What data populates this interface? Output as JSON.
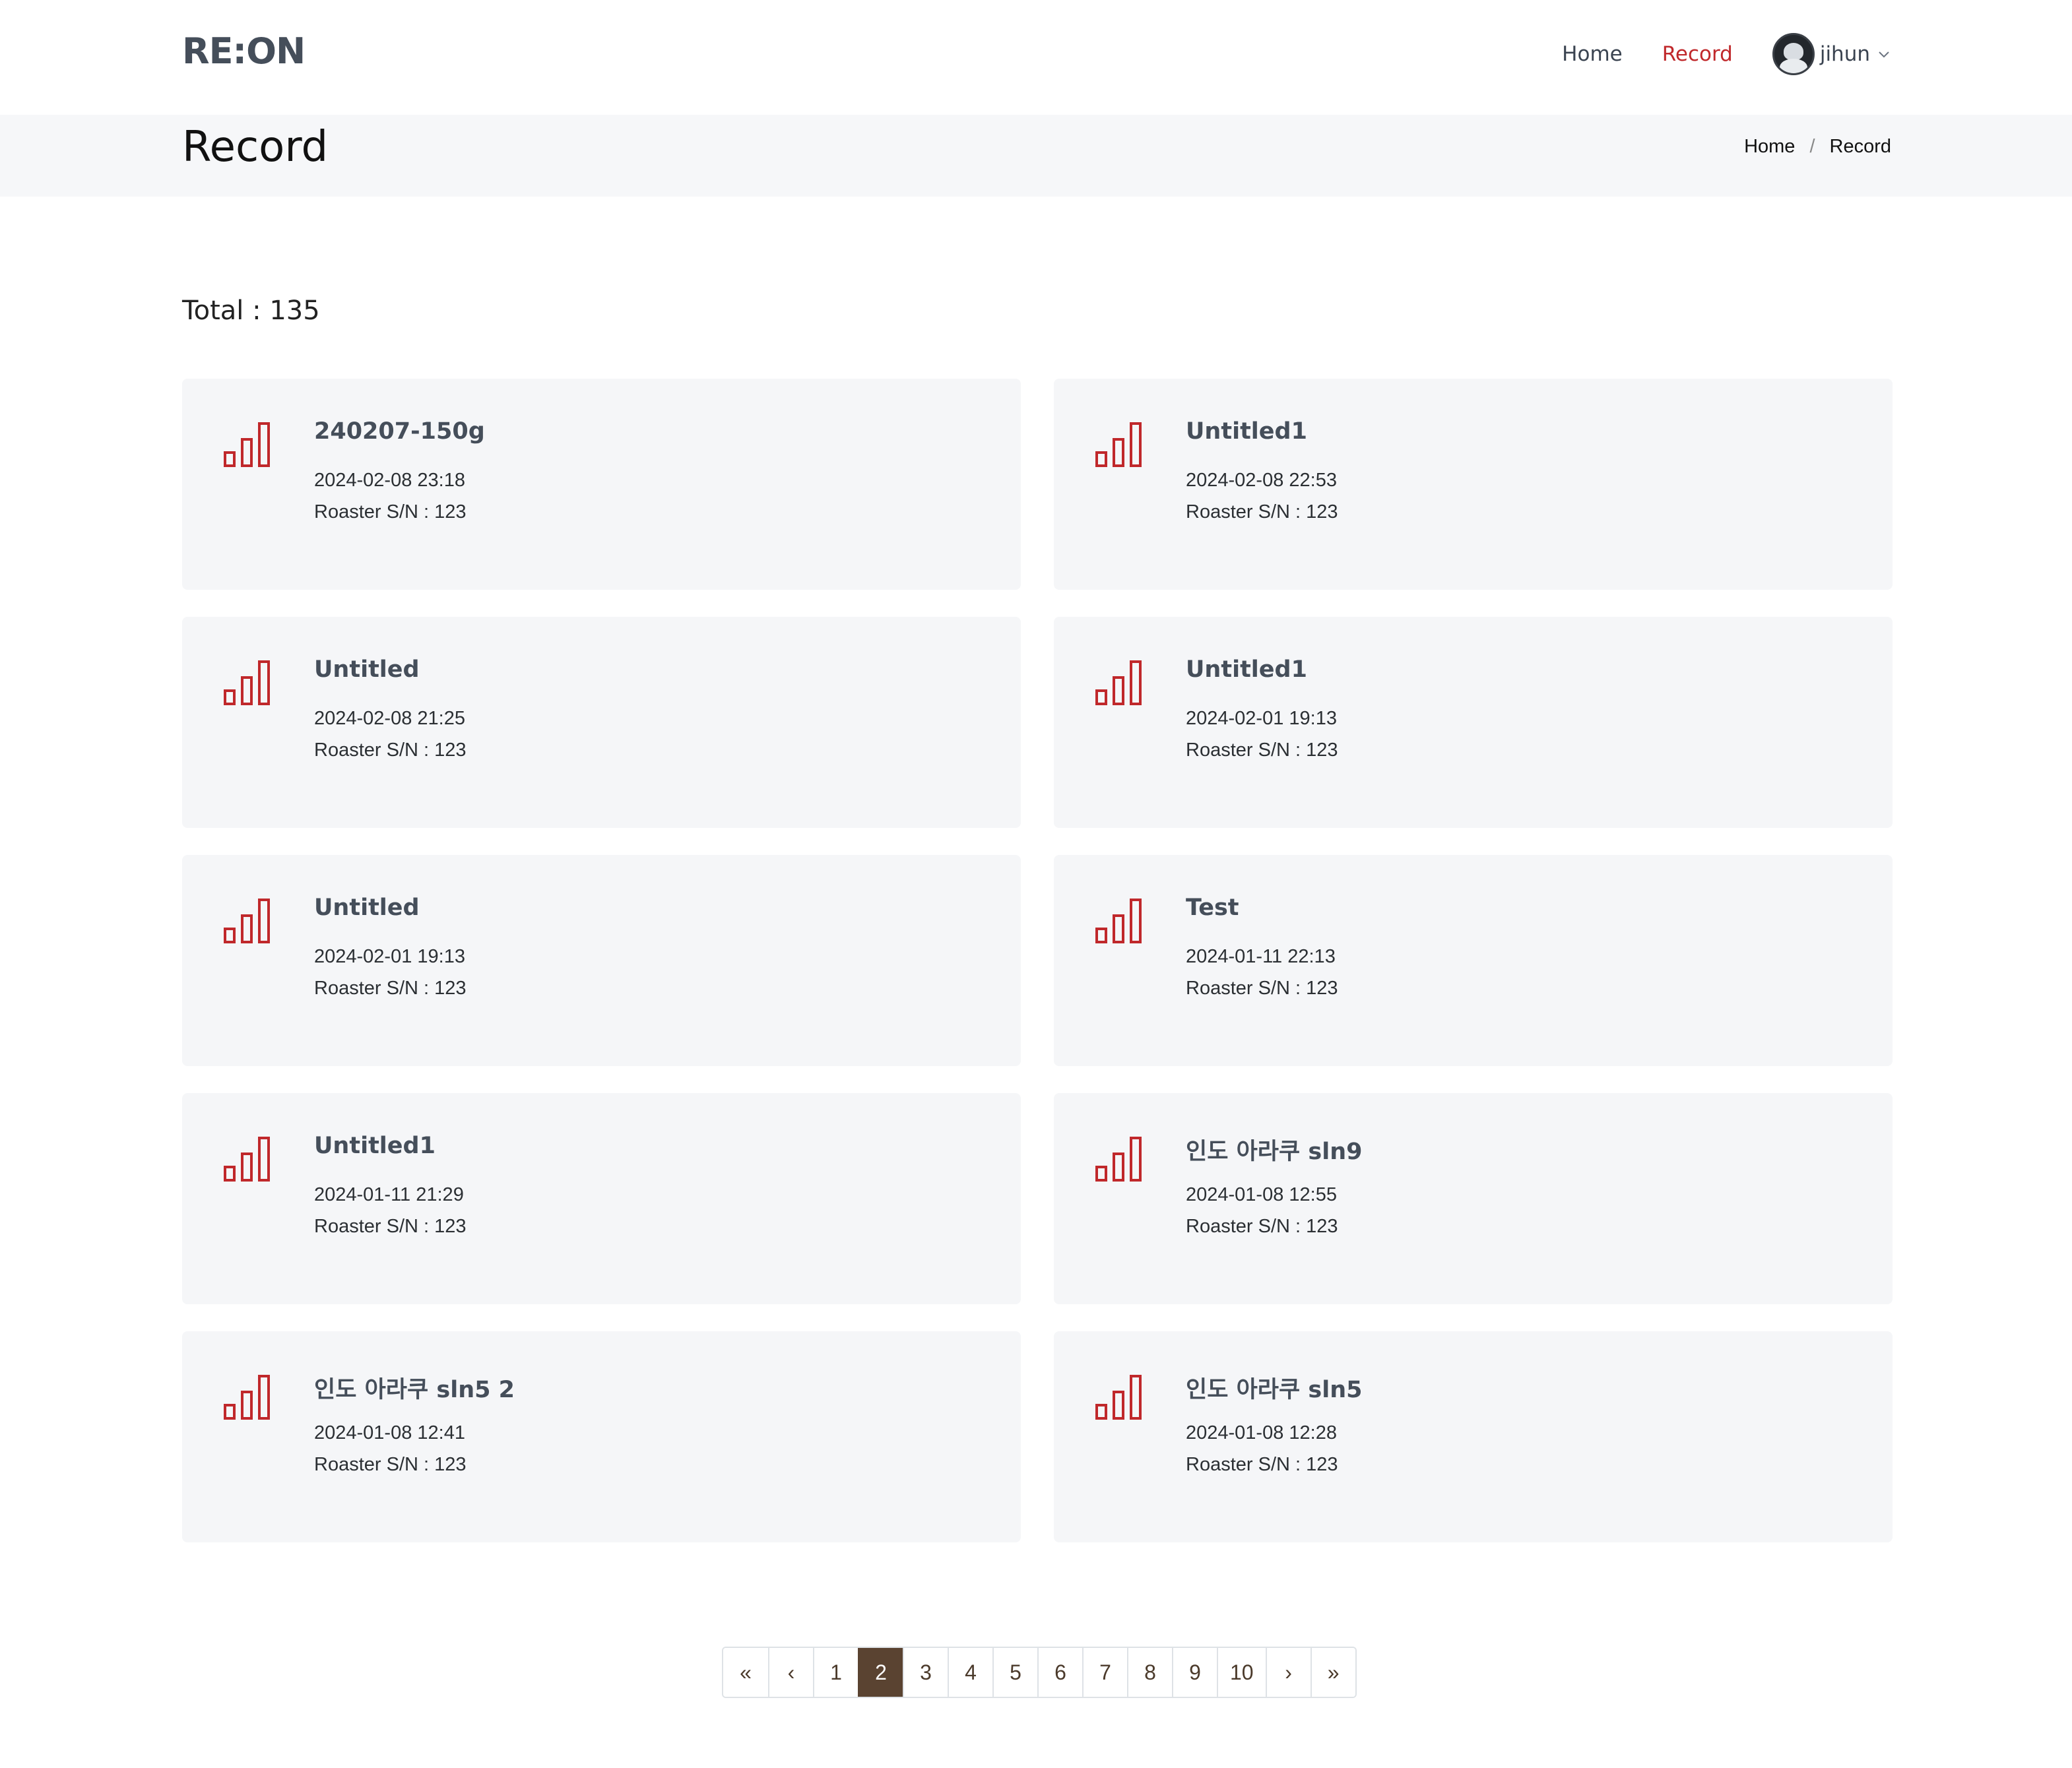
{
  "header": {
    "logo": "RE:ON",
    "nav": [
      {
        "label": "Home",
        "active": false
      },
      {
        "label": "Record",
        "active": true
      }
    ],
    "user": {
      "name": "jihun"
    }
  },
  "titlebar": {
    "title": "Record",
    "breadcrumb": [
      "Home",
      "/",
      "Record"
    ]
  },
  "total_label": "Total : 135",
  "records": [
    {
      "title": "240207-150g",
      "date": "2024-02-08 23:18",
      "sn": "Roaster S/N : 123"
    },
    {
      "title": "Untitled1",
      "date": "2024-02-08 22:53",
      "sn": "Roaster S/N : 123"
    },
    {
      "title": "Untitled",
      "date": "2024-02-08 21:25",
      "sn": "Roaster S/N : 123"
    },
    {
      "title": "Untitled1",
      "date": "2024-02-01 19:13",
      "sn": "Roaster S/N : 123"
    },
    {
      "title": "Untitled",
      "date": "2024-02-01 19:13",
      "sn": "Roaster S/N : 123"
    },
    {
      "title": "Test",
      "date": "2024-01-11 22:13",
      "sn": "Roaster S/N : 123"
    },
    {
      "title": "Untitled1",
      "date": "2024-01-11 21:29",
      "sn": "Roaster S/N : 123"
    },
    {
      "title": "인도 아라쿠 sln9",
      "date": "2024-01-08 12:55",
      "sn": "Roaster S/N : 123"
    },
    {
      "title": "인도 아라쿠 sln5 2",
      "date": "2024-01-08 12:41",
      "sn": "Roaster S/N : 123"
    },
    {
      "title": "인도 아라쿠 sln5",
      "date": "2024-01-08 12:28",
      "sn": "Roaster S/N : 123"
    }
  ],
  "pagination": {
    "items": [
      "«",
      "‹",
      "1",
      "2",
      "3",
      "4",
      "5",
      "6",
      "7",
      "8",
      "9",
      "10",
      "›",
      "»"
    ],
    "current": "2"
  },
  "colors": {
    "accent": "#c0282b",
    "active_page": "#5a4331",
    "card_bg": "#f5f6f8"
  },
  "icons": {
    "record": "bar-chart-icon",
    "user_menu": "chevron-down-icon"
  }
}
